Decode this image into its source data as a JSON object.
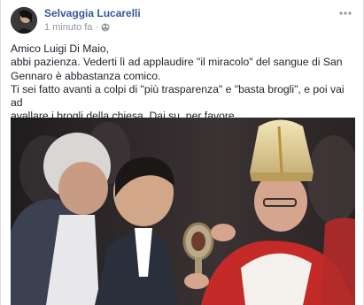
{
  "post": {
    "author": "Selvaggia Lucarelli",
    "timestamp": "1 minuto fa",
    "separator": "·",
    "audience_icon": "globe-icon",
    "menu_icon": "more-options-icon",
    "text_lines": [
      "Amico Luigi Di Maio,",
      "abbi pazienza. Vederti lì ad applaudire \"il miracolo\" del sangue di San",
      "Gennaro è abbastanza comico.",
      "Ti sei fatto avanti a colpi di \"più trasparenza\" e \"basta brogli\", e poi vai ad",
      "avallare i brogli della chiesa. Dai su, per favore."
    ]
  },
  "colors": {
    "author_link": "#365899",
    "meta_grey": "#90949c",
    "text": "#1d2129"
  }
}
